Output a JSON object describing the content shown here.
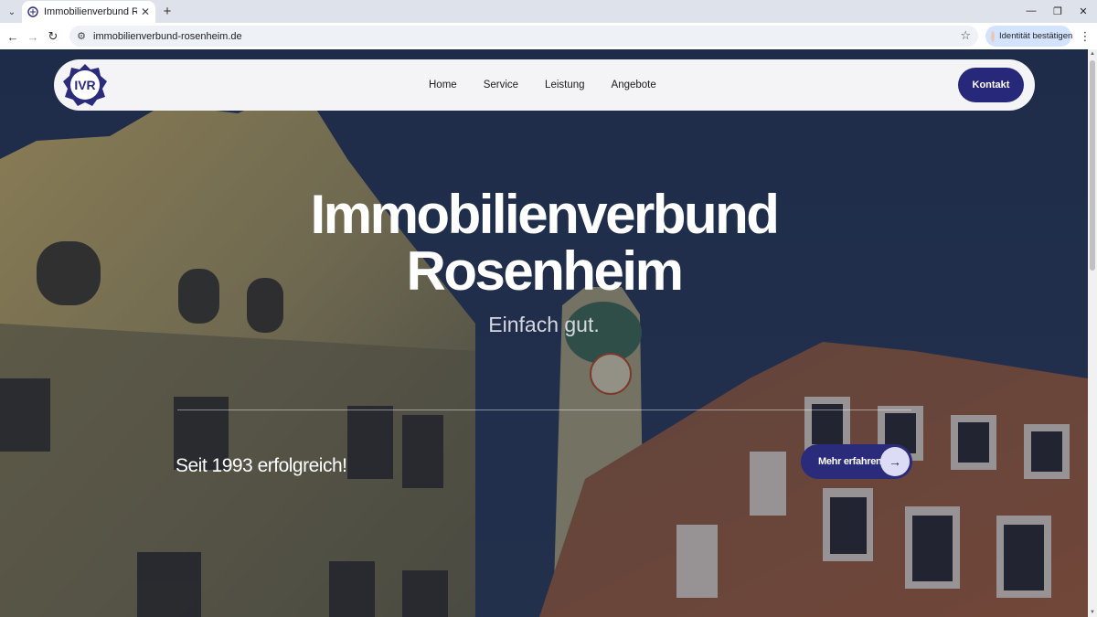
{
  "browser": {
    "tab_title": "Immobilienverbund Rosenheim",
    "tab_close": "✕",
    "new_tab": "+",
    "url": "immobilienverbund-rosenheim.de",
    "identity_label": "Identität bestätigen",
    "icons": [
      "tab-menu-icon",
      "back-icon",
      "forward-icon",
      "reload-icon",
      "site-settings-icon",
      "bookmark-star-icon",
      "menu-kebab-icon",
      "minimize-icon",
      "maximize-icon",
      "close-icon"
    ]
  },
  "site": {
    "logo_text": "IVR",
    "nav": [
      {
        "label": "Home"
      },
      {
        "label": "Service"
      },
      {
        "label": "Leistung"
      },
      {
        "label": "Angebote"
      }
    ],
    "contact_label": "Kontakt",
    "hero": {
      "title_line1": "Immobilienverbund",
      "title_line2": "Rosenheim",
      "subtitle": "Einfach gut.",
      "since": "Seit 1993 erfolgreich!",
      "cta_label": "Mehr erfahren"
    },
    "colors": {
      "brand": "#28287a",
      "cta_circle": "#dcdcf4",
      "nav_bg": "#f4f4f6"
    }
  }
}
